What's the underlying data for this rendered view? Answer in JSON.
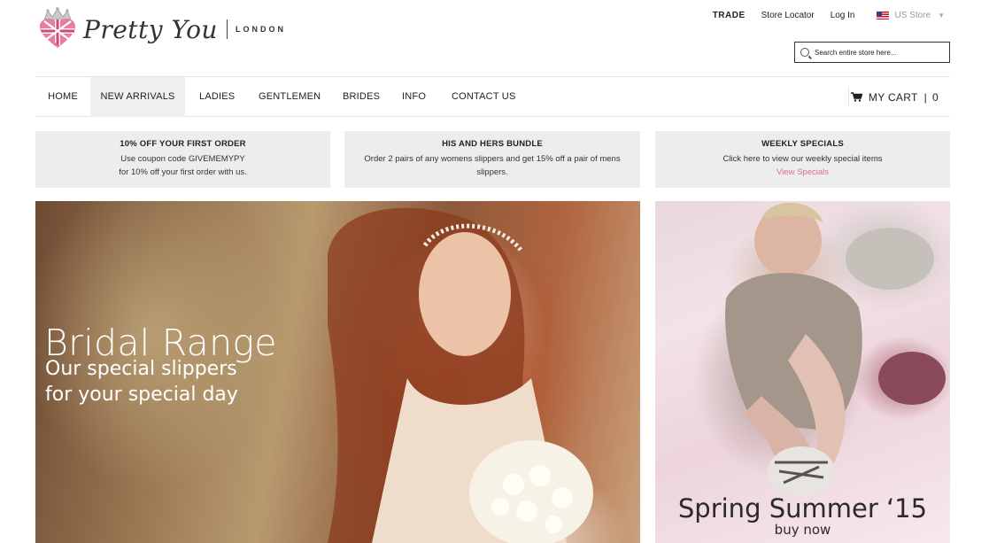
{
  "logo": {
    "script": "Pretty You",
    "sub": "LONDON"
  },
  "top_links": {
    "trade": "TRADE",
    "store_locator": "Store Locator",
    "login": "Log In",
    "store": "US Store"
  },
  "search": {
    "placeholder": "Search entire store here..."
  },
  "nav": {
    "items": [
      "HOME",
      "NEW ARRIVALS",
      "LADIES",
      "GENTLEMEN",
      "BRIDES",
      "INFO",
      "CONTACT US"
    ],
    "active": "NEW ARRIVALS",
    "cart_label": "MY CART",
    "cart_sep": "|",
    "cart_count": "0"
  },
  "promos": [
    {
      "title": "10% OFF YOUR FIRST ORDER",
      "lines": [
        "Use coupon code GIVEMEMYPY",
        "for 10% off your first order with us."
      ]
    },
    {
      "title": "HIS AND HERS BUNDLE",
      "lines": [
        "Order 2 pairs of any womens slippers and get 15% off a pair of mens",
        "slippers."
      ]
    },
    {
      "title": "WEEKLY SPECIALS",
      "lines": [
        "Click here to view our weekly special items"
      ],
      "link": "View Specials"
    }
  ],
  "banners": {
    "left": {
      "title": "Bridal Range",
      "line1": "Our special slippers",
      "line2": "for your special day"
    },
    "right": {
      "title": "Spring Summer ‘15",
      "subtitle": "buy now"
    }
  },
  "colors": {
    "accent_pink": "#e06a8f",
    "promo_bg": "#ededed",
    "nav_active_bg": "#f0f0f0"
  }
}
